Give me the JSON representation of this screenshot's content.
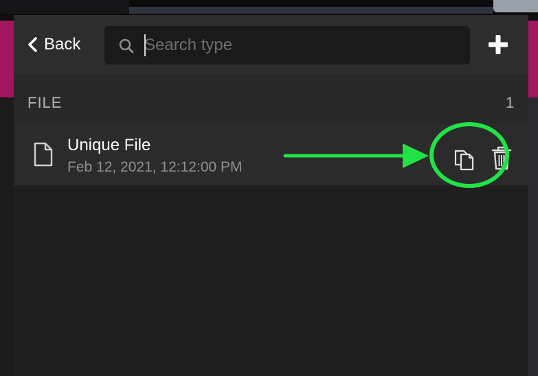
{
  "header": {
    "back_label": "Back",
    "search_placeholder": "Search type",
    "search_value": ""
  },
  "section": {
    "title": "FILE",
    "count": "1"
  },
  "files": [
    {
      "name": "Unique File",
      "date": "Feb 12, 2021, 12:12:00 PM"
    }
  ],
  "icons": {
    "back": "chevron-left-icon",
    "search": "search-icon",
    "add": "plus-icon",
    "file": "file-icon",
    "copy": "copy-icon",
    "delete": "trash-icon"
  },
  "colors": {
    "panel_background": "#1f1f1f",
    "header_background": "#2d2d2d",
    "row_background": "#2b2b2b",
    "accent_pink": "#a3155f",
    "annotation_green": "#21e246"
  }
}
